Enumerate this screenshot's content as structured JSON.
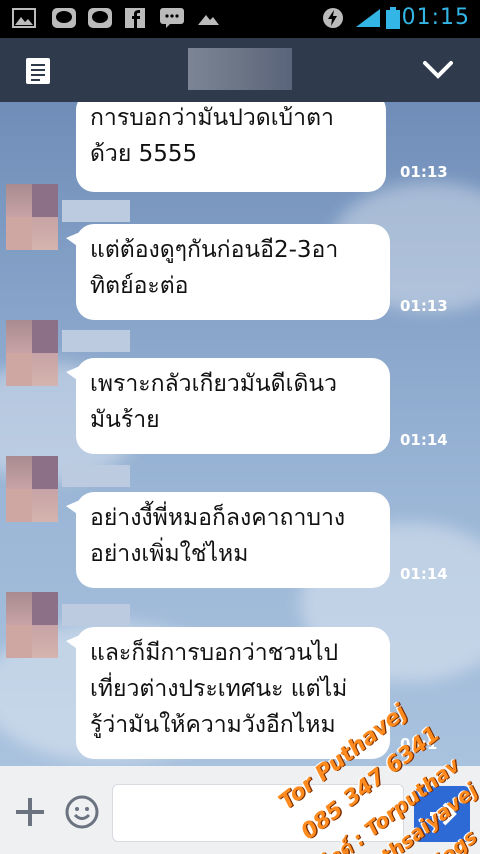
{
  "status_bar": {
    "time": "01:15",
    "icons": [
      "gallery-icon",
      "line-icon",
      "line-icon",
      "facebook-icon",
      "chat-icon",
      "cloud-icon",
      "battery-saver-icon",
      "wifi-icon",
      "signal-icon",
      "battery-icon"
    ],
    "accent": "#33b5e5"
  },
  "header": {
    "background": "#2f3a4d",
    "menu_icon": "notes-icon",
    "collapse_icon": "chevron-down-icon"
  },
  "messages": [
    {
      "text_line1": "การบอกว่ามันปวดเบ้าตา",
      "text_line2": "ด้วย 5555",
      "time": "01:13"
    },
    {
      "text_line1": "แต่ต้องดูๆกันก่อนอี2-3อา",
      "text_line2": "ทิตย์อะต่อ",
      "time": "01:13"
    },
    {
      "text_line1": "เพราะกลัวเกียวมันดีเดินว",
      "text_line2": "มันร้าย",
      "time": "01:14"
    },
    {
      "text_line1": "อย่างงี้พี่หมอก็ลงคาถาบาง",
      "text_line2": "อย่างเพิ่มใช่ไหม",
      "time": "01:14"
    },
    {
      "text_line1": "และก็มีการบอกว่าชวนไป",
      "text_line2": "เที่ยวต่างประเทศนะ แต่ไม่",
      "text_line3": "รู้ว่ามันให้ความวังอีกไหม",
      "time": "01:1"
    }
  ],
  "input_bar": {
    "plus_icon": "plus-icon",
    "emoji_icon": "emoji-icon",
    "send_icon": "send-icon"
  },
  "watermark": {
    "line1": "Tor Puthavej",
    "line2": "085 347 6341",
    "line3": "ไลด์ : Torputhav",
    "line4": "puthsaiyavej",
    "line5": "i.blogs"
  }
}
